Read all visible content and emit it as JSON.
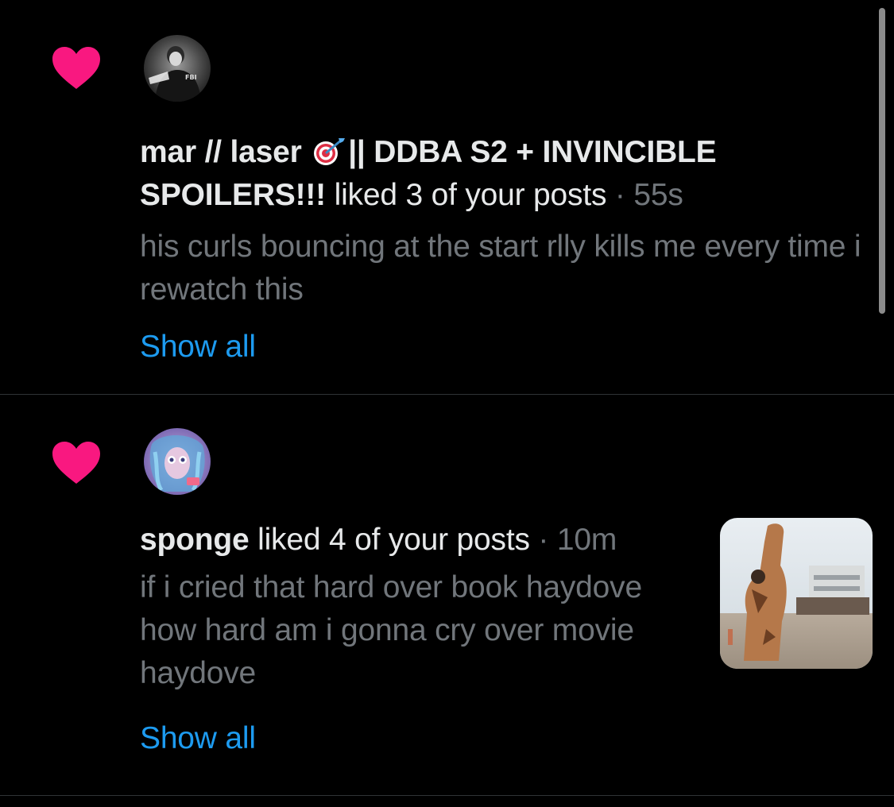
{
  "notifications": [
    {
      "icon": "heart-icon",
      "username_part1": "mar // laser",
      "username_emoji": "direct-hit-emoji",
      "username_part2": "|| DDBA S2 + INVINCIBLE SPOILERS!!!",
      "action": "liked 3 of your posts",
      "separator": "·",
      "time": "55s",
      "preview": "his curls bouncing at the start rlly kills me every time i rewatch this",
      "show_all": "Show all"
    },
    {
      "icon": "heart-icon",
      "username": "sponge",
      "action": "liked 4 of your posts",
      "separator": "·",
      "time": "10m",
      "preview": "if i cried that hard over book haydove how hard am i gonna cry over movie haydove",
      "show_all": "Show all"
    }
  ],
  "colors": {
    "background": "#000000",
    "heart": "#f91880",
    "link": "#1d9bf0",
    "primary_text": "#e7e9ea",
    "secondary_text": "#71767b",
    "divider": "#2f3336"
  }
}
